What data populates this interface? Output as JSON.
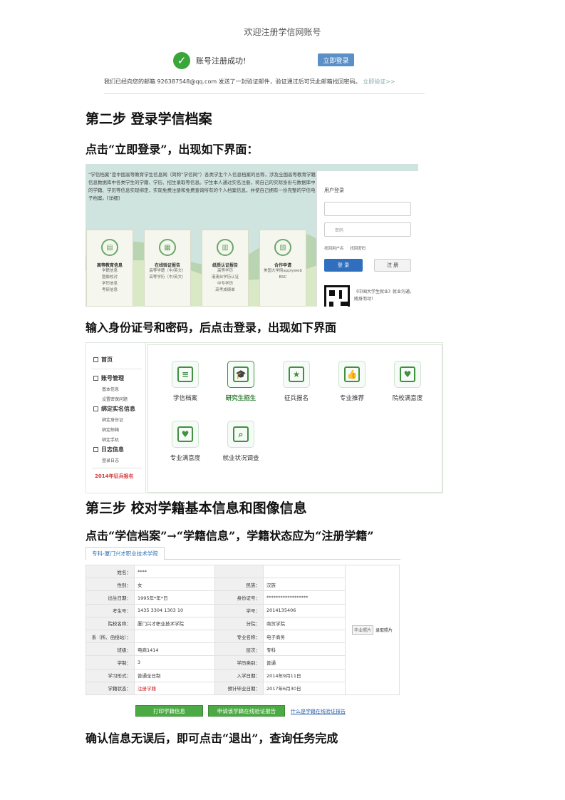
{
  "reg": {
    "title": "欢迎注册学信网账号",
    "success_text": "账号注册成功!",
    "login_now": "立即登录",
    "mail_note": "我们已经向您的邮箱 926387548@qq.com 发送了一封验证邮件，验证通过后可凭此邮箱找回密码。",
    "verify_link": "立即验证>>"
  },
  "step2": {
    "heading": "第二步 登录学信档案",
    "instruction": "点击“立即登录”，出现如下界面："
  },
  "login_page": {
    "intro": "“学信档案”是中国高等教育学生信息网（简称“学信网”）各类学生个人信息档案的总称，涉及全国高等教育学籍信息数据库中各类学生的学籍、学历、招生录取等信息。学生本人通过实名注册，将自己的实际身份与数据库中的学籍、学历等信息实现绑定，实现免费注册和免费查询所有的个人档案信息，并使自己拥有一份完整的学信电子档案。[详细]",
    "cards": [
      {
        "title": "高等教育信息",
        "items": [
          "学籍信息",
          "图像校对",
          "学历信息",
          "考研信息"
        ]
      },
      {
        "title": "在线验证报告",
        "items": [
          "高等学籍（中/英文）",
          "高等学历（中/英文）"
        ]
      },
      {
        "title": "纸质认证报告",
        "items": [
          "高等学历",
          "港澳台学历认证",
          "中专学历",
          "高考成绩单"
        ]
      },
      {
        "title": "合作申请",
        "items": [
          "美国大学网applyweb",
          "BSC"
        ]
      }
    ],
    "panel_title": "用户登录",
    "user_placeholder": "",
    "pwd_placeholder": "密码",
    "forgot_user": "找回用户名",
    "forgot_pwd": "找回密码",
    "login_btn": "登  录",
    "register_btn": "注  册",
    "qr_text": "《中国大学生就业》就业沟通，随身而动！"
  },
  "after_login": {
    "instruction": "输入身份证号和密码，后点击登录，出现如下界面"
  },
  "dashboard": {
    "sidebar": {
      "home": "首页",
      "account": "账号管理",
      "account_items": [
        "基本信息",
        "设置密保问题"
      ],
      "bind": "绑定实名信息",
      "bind_items": [
        "绑定身份证",
        "绑定邮箱",
        "绑定手机"
      ],
      "log": "日志信息",
      "log_items": [
        "登录日志"
      ],
      "promo": "2014年征兵报名"
    },
    "tiles": [
      {
        "label": "学信档案",
        "icon": "≡"
      },
      {
        "label": "研究生招生",
        "icon": "🎓"
      },
      {
        "label": "征兵报名",
        "icon": "★"
      },
      {
        "label": "专业推荐",
        "icon": "👍"
      },
      {
        "label": "院校满意度",
        "icon": "♥"
      },
      {
        "label": "专业满意度",
        "icon": "♥"
      },
      {
        "label": "就业状况调查",
        "icon": "⌕"
      }
    ]
  },
  "step3": {
    "heading": "第三步  校对学籍基本信息和图像信息",
    "instruction": "点击“学信档案”→“学籍信息”，学籍状态应为“注册学籍”"
  },
  "record": {
    "tab": "专科-厦门兴才职业技术学院",
    "rows": [
      {
        "l1": "姓名：",
        "v1": "****",
        "l2": "",
        "v2": ""
      },
      {
        "l1": "性别：",
        "v1": "女",
        "l2": "民族：",
        "v2": "汉族"
      },
      {
        "l1": "出生日期：",
        "v1": "1995年*年*日",
        "l2": "身份证号：",
        "v2": "******************"
      },
      {
        "l1": "考生号：",
        "v1": "1435 3304 1303 10",
        "l2": "学号：",
        "v2": "2014135406"
      },
      {
        "l1": "院校名称：",
        "v1": "厦门兴才职业技术学院",
        "l2": "分院：",
        "v2": "商贸学院"
      },
      {
        "l1": "系（所、函授站）：",
        "v1": "",
        "l2": "专业名称：",
        "v2": "电子商务"
      },
      {
        "l1": "班级：",
        "v1": "电商1414",
        "l2": "层次：",
        "v2": "专科"
      },
      {
        "l1": "学制：",
        "v1": "3",
        "l2": "学历类别：",
        "v2": "普通"
      },
      {
        "l1": "学习形式：",
        "v1": "普通全日制",
        "l2": "入学日期：",
        "v2": "2014年9月11日"
      },
      {
        "l1": "学籍状态：",
        "v1": "注册学籍",
        "l2": "预计毕业日期：",
        "v2": "2017年6月30日"
      }
    ],
    "photo_btn1": "毕业照片",
    "photo_btn2": "录取照片",
    "print_btn": "打印学籍信息",
    "apply_btn": "申请该学籍在线验证报告",
    "what_link": "什么是学籍在线验证报告"
  },
  "final": {
    "text": "确认信息无误后，即可点击“退出”，查询任务完成"
  }
}
